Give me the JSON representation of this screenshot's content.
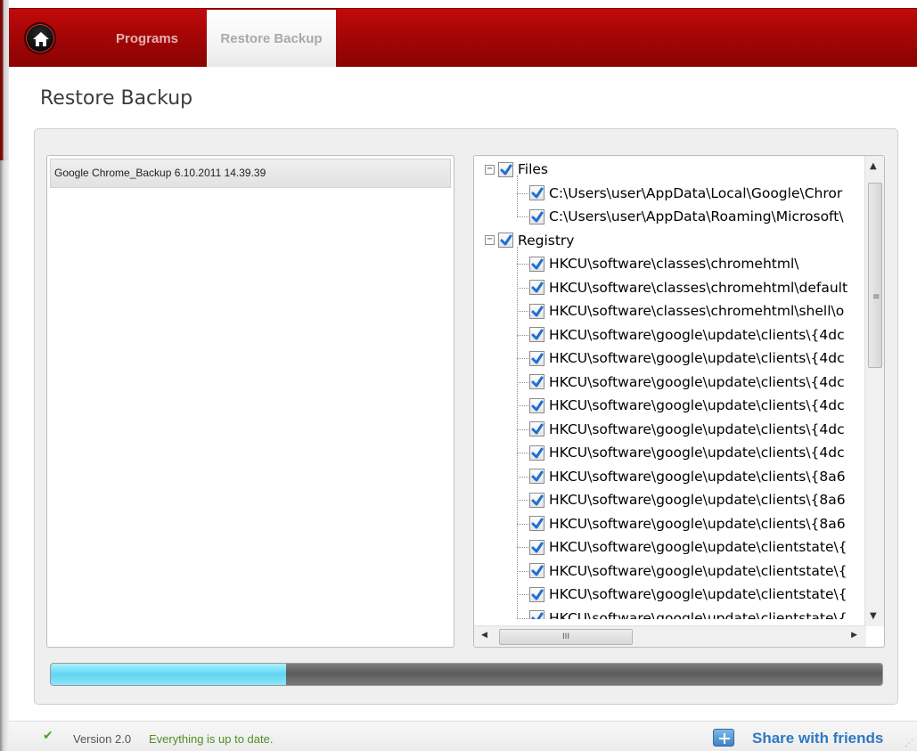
{
  "nav": {
    "home_icon": "home-icon",
    "tabs": [
      {
        "label": "Programs",
        "active": false
      },
      {
        "label": "Restore Backup",
        "active": true
      }
    ]
  },
  "page": {
    "title": "Restore Backup"
  },
  "backups": {
    "items": [
      {
        "label": "Google Chrome_Backup 6.10.2011 14.39.39",
        "selected": true
      }
    ]
  },
  "tree": {
    "groups": [
      {
        "label": "Files",
        "checked": true,
        "children": [
          {
            "label": "C:\\Users\\user\\AppData\\Local\\Google\\Chror",
            "checked": true
          },
          {
            "label": "C:\\Users\\user\\AppData\\Roaming\\Microsoft\\",
            "checked": true
          }
        ]
      },
      {
        "label": "Registry",
        "checked": true,
        "children": [
          {
            "label": "HKCU\\software\\classes\\chromehtml\\",
            "checked": true
          },
          {
            "label": "HKCU\\software\\classes\\chromehtml\\default",
            "checked": true
          },
          {
            "label": "HKCU\\software\\classes\\chromehtml\\shell\\o",
            "checked": true
          },
          {
            "label": "HKCU\\software\\google\\update\\clients\\{4dc",
            "checked": true
          },
          {
            "label": "HKCU\\software\\google\\update\\clients\\{4dc",
            "checked": true
          },
          {
            "label": "HKCU\\software\\google\\update\\clients\\{4dc",
            "checked": true
          },
          {
            "label": "HKCU\\software\\google\\update\\clients\\{4dc",
            "checked": true
          },
          {
            "label": "HKCU\\software\\google\\update\\clients\\{4dc",
            "checked": true
          },
          {
            "label": "HKCU\\software\\google\\update\\clients\\{4dc",
            "checked": true
          },
          {
            "label": "HKCU\\software\\google\\update\\clients\\{8a6",
            "checked": true
          },
          {
            "label": "HKCU\\software\\google\\update\\clients\\{8a6",
            "checked": true
          },
          {
            "label": "HKCU\\software\\google\\update\\clients\\{8a6",
            "checked": true
          },
          {
            "label": "HKCU\\software\\google\\update\\clientstate\\{",
            "checked": true
          },
          {
            "label": "HKCU\\software\\google\\update\\clientstate\\{",
            "checked": true
          },
          {
            "label": "HKCU\\software\\google\\update\\clientstate\\{",
            "checked": true
          },
          {
            "label": "HKCU\\software\\google\\update\\clientstate\\{",
            "checked": true
          }
        ]
      }
    ],
    "hscroll_grip": "III",
    "vscroll_grip": "≡"
  },
  "progress": {
    "fraction": 0.283
  },
  "status": {
    "check_icon": "check-icon",
    "version": "Version 2.0",
    "message": "Everything is up to date.",
    "share_label": "Share with friends",
    "share_icon": "share-icon"
  },
  "colors": {
    "brand_red": "#a50606",
    "progress_fill": "#5fd4f2",
    "status_green": "#4e8f22",
    "link_blue": "#2f78c2"
  }
}
